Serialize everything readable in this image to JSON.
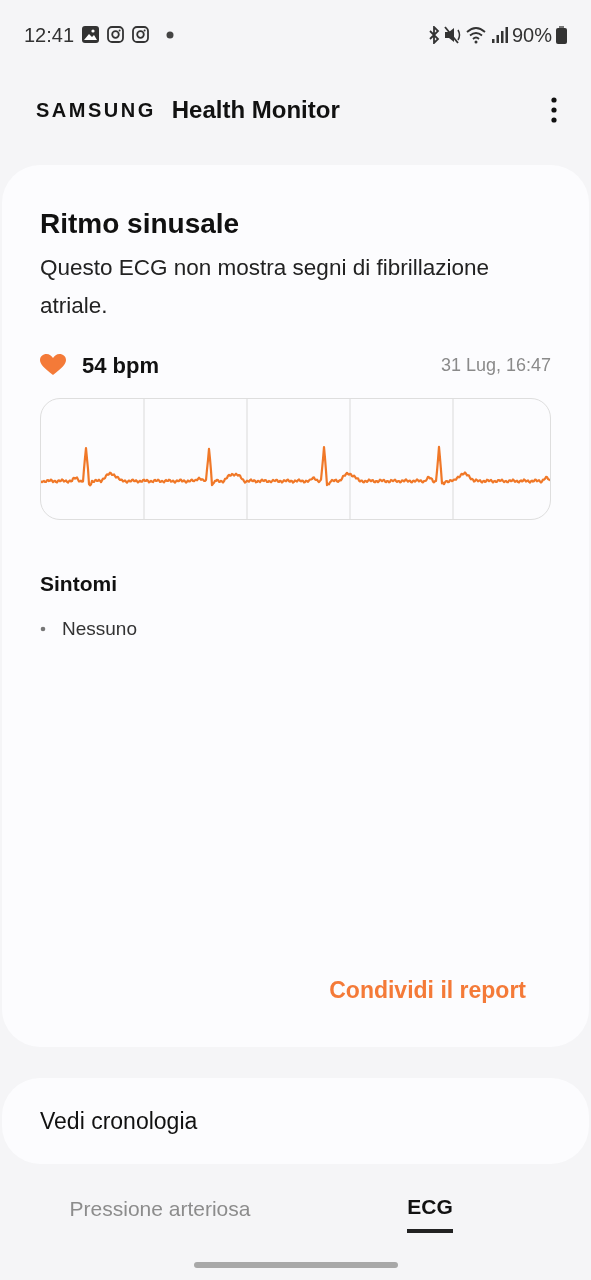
{
  "status_bar": {
    "time": "12:41",
    "battery": "90%"
  },
  "header": {
    "brand": "SAMSUNG",
    "title": "Health Monitor"
  },
  "result": {
    "title": "Ritmo sinusale",
    "description": "Questo ECG non mostra segni di fibrillazione atriale.",
    "heart_rate": "54 bpm",
    "timestamp": "31 Lug, 16:47",
    "symptoms_title": "Sintomi",
    "symptoms": [
      "Nessuno"
    ],
    "share_link": "Condividi il report"
  },
  "history": {
    "label": "Vedi cronologia"
  },
  "tabs": [
    {
      "label": "Pressione arteriosa",
      "selected": false
    },
    {
      "label": "ECG",
      "selected": true
    }
  ]
}
